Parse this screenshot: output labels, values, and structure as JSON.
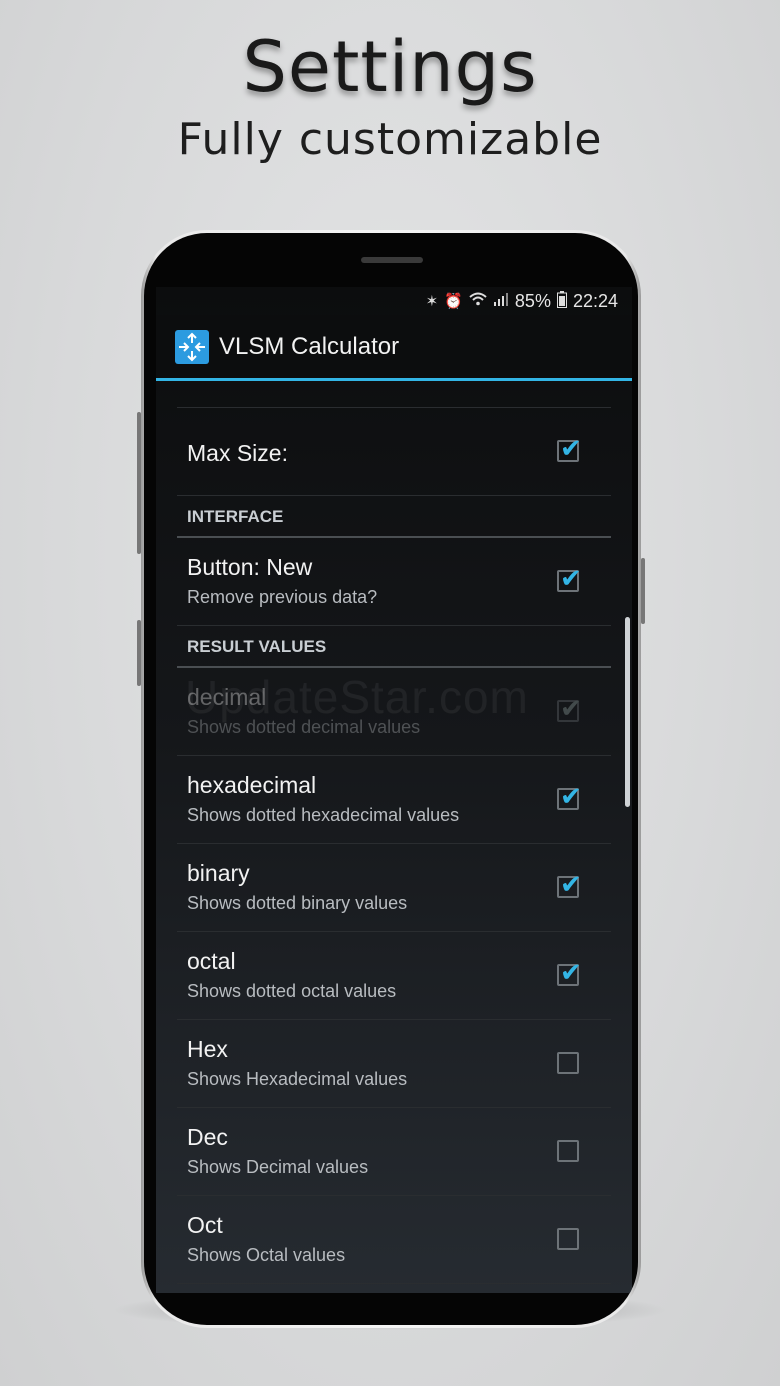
{
  "promo": {
    "title": "Settings",
    "subtitle": "Fully customizable"
  },
  "status_bar": {
    "battery": "85%",
    "time": "22:24",
    "icons": [
      "bluetooth-icon",
      "alarm-icon",
      "wifi-icon",
      "signal-icon",
      "battery-icon"
    ]
  },
  "app_bar": {
    "title": "VLSM Calculator",
    "accent_color": "#33b5e5"
  },
  "settings": {
    "max_size": {
      "title": "Max Size:",
      "checked": true
    },
    "interface_header": "INTERFACE",
    "button_new": {
      "title": "Button: New",
      "summary": "Remove previous data?",
      "checked": true
    },
    "result_values_header": "RESULT VALUES",
    "items": [
      {
        "title": "decimal",
        "summary": "Shows dotted decimal values",
        "checked": true,
        "enabled": false
      },
      {
        "title": "hexadecimal",
        "summary": "Shows dotted hexadecimal values",
        "checked": true,
        "enabled": true
      },
      {
        "title": "binary",
        "summary": "Shows dotted binary values",
        "checked": true,
        "enabled": true
      },
      {
        "title": "octal",
        "summary": "Shows dotted octal values",
        "checked": true,
        "enabled": true
      },
      {
        "title": "Hex",
        "summary": "Shows Hexadecimal values",
        "checked": false,
        "enabled": true
      },
      {
        "title": "Dec",
        "summary": "Shows Decimal values",
        "checked": false,
        "enabled": true
      },
      {
        "title": "Oct",
        "summary": "Shows Octal values",
        "checked": false,
        "enabled": true
      }
    ]
  },
  "watermark": "UpdateStar.com"
}
